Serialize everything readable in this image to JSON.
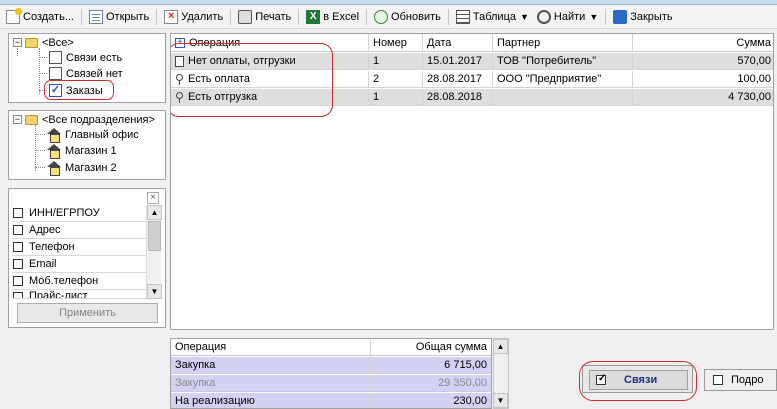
{
  "toolbar": {
    "create": "Создать...",
    "open": "Открыть",
    "delete": "Удалить",
    "print": "Печать",
    "excel": "в Excel",
    "refresh": "Обновить",
    "table": "Таблица",
    "find": "Найти",
    "close": "Закрыть"
  },
  "tree_links": {
    "root": "<Все>",
    "items": [
      "Связи есть",
      "Связей нет",
      "Заказы"
    ]
  },
  "tree_units": {
    "root": "<Все подразделения>",
    "items": [
      "Главный офис",
      "Магазин 1",
      "Магазин 2"
    ]
  },
  "fields_panel": {
    "items": [
      "ИНН/ЕГРПОУ",
      "Адрес",
      "Телефон",
      "Email",
      "Моб.телефон",
      "Прайс-лист"
    ],
    "apply": "Применить"
  },
  "main_grid": {
    "columns": [
      "Операция",
      "Номер",
      "Дата",
      "Партнер",
      "Сумма"
    ],
    "rows": [
      {
        "icon": "document-icon",
        "operation": "Нет оплаты, отгрузки",
        "number": "1",
        "date": "15.01.2017",
        "partner": "ТОВ \"Потребитель\"",
        "sum": "570,00"
      },
      {
        "icon": "key-icon",
        "operation": "Есть оплата",
        "number": "2",
        "date": "28.08.2017",
        "partner": "ООО \"Предприятие\"",
        "sum": "100,00"
      },
      {
        "icon": "key-icon",
        "operation": "Есть отгрузка",
        "number": "1",
        "date": "28.08.2018",
        "partner": "",
        "sum": "4 730,00"
      }
    ]
  },
  "summary_grid": {
    "columns": [
      "Операция",
      "Общая сумма"
    ],
    "rows": [
      {
        "operation": "Закупка",
        "sum": "6 715,00"
      },
      {
        "operation": "Закупка",
        "sum": "29 350,00"
      },
      {
        "operation": "На реализацию",
        "sum": "230,00"
      }
    ]
  },
  "bottom": {
    "links_label": "Связи",
    "podr_label": "Подро"
  },
  "colors": {
    "highlight": "#d12b2b",
    "summary_row": "#d4d2f3",
    "links_text": "#1c2f80"
  }
}
